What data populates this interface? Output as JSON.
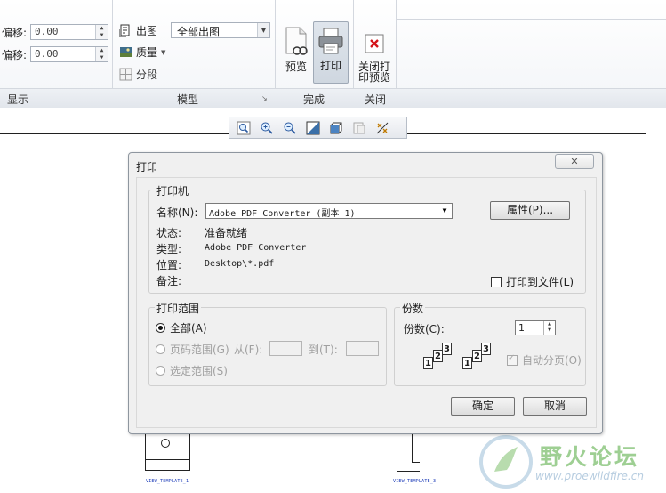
{
  "ribbon": {
    "display_group": {
      "offset1_label": "偏移:",
      "offset1_value": "0.00",
      "offset2_label": "偏移:",
      "offset2_value": "0.00",
      "label": "显示"
    },
    "model_group": {
      "output_label": "出图",
      "output_select": "全部出图",
      "quality_label": "质量",
      "segment_label": "分段",
      "label": "模型"
    },
    "done_group": {
      "preview_label": "预览",
      "print_label": "打印",
      "label": "完成"
    },
    "close_group": {
      "close_label_1": "关闭打",
      "close_label_2": "印预览",
      "label": "关闭"
    }
  },
  "drawing": {
    "view_label_1": "VIEW_TEMPLATE_1",
    "view_label_2": "VIEW_TEMPLATE_3"
  },
  "watermark": {
    "text": "野火论坛",
    "url": "www.proewildfire.cn"
  },
  "dialog": {
    "title": "打印",
    "close_symbol": "✕",
    "printer_section": {
      "legend": "打印机",
      "name_label": "名称(N):",
      "name_value": "Adobe PDF Converter (副本 1)",
      "properties_button": "属性(P)...",
      "status_label": "状态:",
      "status_value": "准备就绪",
      "type_label": "类型:",
      "type_value": "Adobe PDF Converter",
      "location_label": "位置:",
      "location_value": "Desktop\\*.pdf",
      "comment_label": "备注:",
      "print_to_file_label": "打印到文件(L)"
    },
    "range_section": {
      "legend": "打印范围",
      "all_label": "全部(A)",
      "pages_label": "页码范围(G)",
      "from_label": "从(F):",
      "to_label": "到(T):",
      "selection_label": "选定范围(S)"
    },
    "copies_section": {
      "legend": "份数",
      "copies_label": "份数(C):",
      "copies_value": "1",
      "collate_label": "自动分页(O)",
      "card_1": "1",
      "card_2": "2",
      "card_3": "3"
    },
    "ok_button": "确定",
    "cancel_button": "取消"
  }
}
